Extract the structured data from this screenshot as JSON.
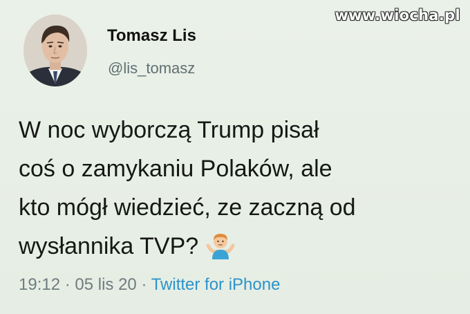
{
  "watermark": "www.wiocha.pl",
  "author": {
    "name": "Tomasz Lis",
    "handle": "@lis_tomasz",
    "avatar_icon": "profile-photo"
  },
  "tweet": {
    "lines": [
      "W noc wyborczą Trump pisał",
      "coś o zamykaniu Polaków, ale",
      "kto mógł wiedzieć, ze zaczną od",
      "wysłannika TVP?"
    ],
    "emoji_icon": "person-shrugging-emoji"
  },
  "meta": {
    "time": "19:12",
    "separator": " · ",
    "date": "05 lis 20",
    "source": "Twitter for iPhone"
  },
  "colors": {
    "background": "#e8efe6",
    "link": "#2d93c9",
    "muted": "#6f7c80"
  }
}
